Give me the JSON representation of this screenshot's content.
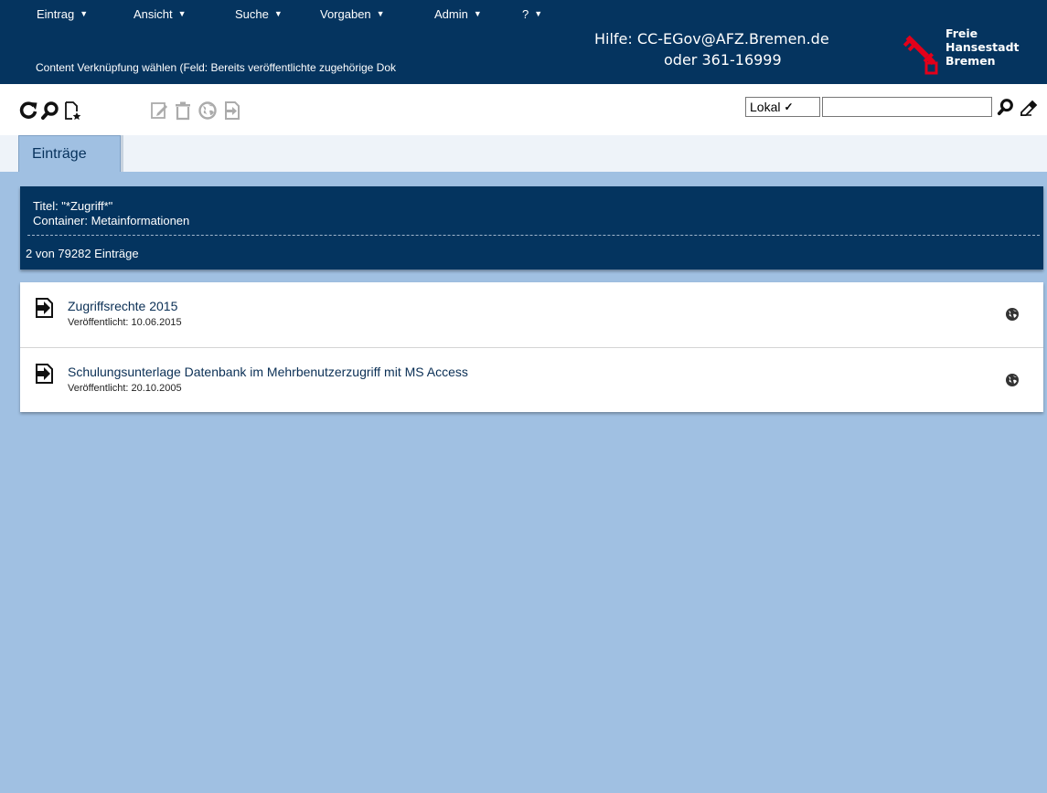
{
  "menu": [
    {
      "label": "Eintrag",
      "caret": "▼"
    },
    {
      "label": "Ansicht",
      "caret": "▼"
    },
    {
      "label": "Suche",
      "caret": "▼"
    },
    {
      "label": "Vorgaben",
      "caret": "▼"
    },
    {
      "label": "Admin",
      "caret": "▼"
    },
    {
      "label": "?",
      "caret": "▼"
    }
  ],
  "header": {
    "subtitle": "Content Verknüpfung wählen (Feld: Bereits veröffentlichte zugehörige Dok",
    "help_line1": "Hilfe: CC-EGov@AFZ.Bremen.de",
    "help_line2": "oder 361-16999",
    "logo_line1": "Freie",
    "logo_line2": "Hansestadt",
    "logo_line3": "Bremen"
  },
  "toolbar": {
    "icons": [
      "refresh-icon",
      "search-icon",
      "new-entry-icon",
      "edit-icon",
      "delete-icon",
      "publish-icon",
      "link-icon"
    ],
    "scope_value": "Lokal",
    "search_value": ""
  },
  "tabs": [
    {
      "label": "Einträge"
    }
  ],
  "info": {
    "title_filter": "Titel: \"*Zugriff*\"",
    "container": "Container: Metainformationen",
    "count": "2 von 79282 Einträge"
  },
  "results": [
    {
      "title": "Zugriffsrechte 2015",
      "meta": "Veröffentlicht: 10.06.2015"
    },
    {
      "title": "Schulungsunterlage Datenbank im Mehrbenutzerzugriff mit MS Access",
      "meta": "Veröffentlicht: 20.10.2005"
    }
  ],
  "colors": {
    "header_bg": "#05345f",
    "page_bg": "#a0c0e2",
    "logo_red": "#e2001a"
  }
}
